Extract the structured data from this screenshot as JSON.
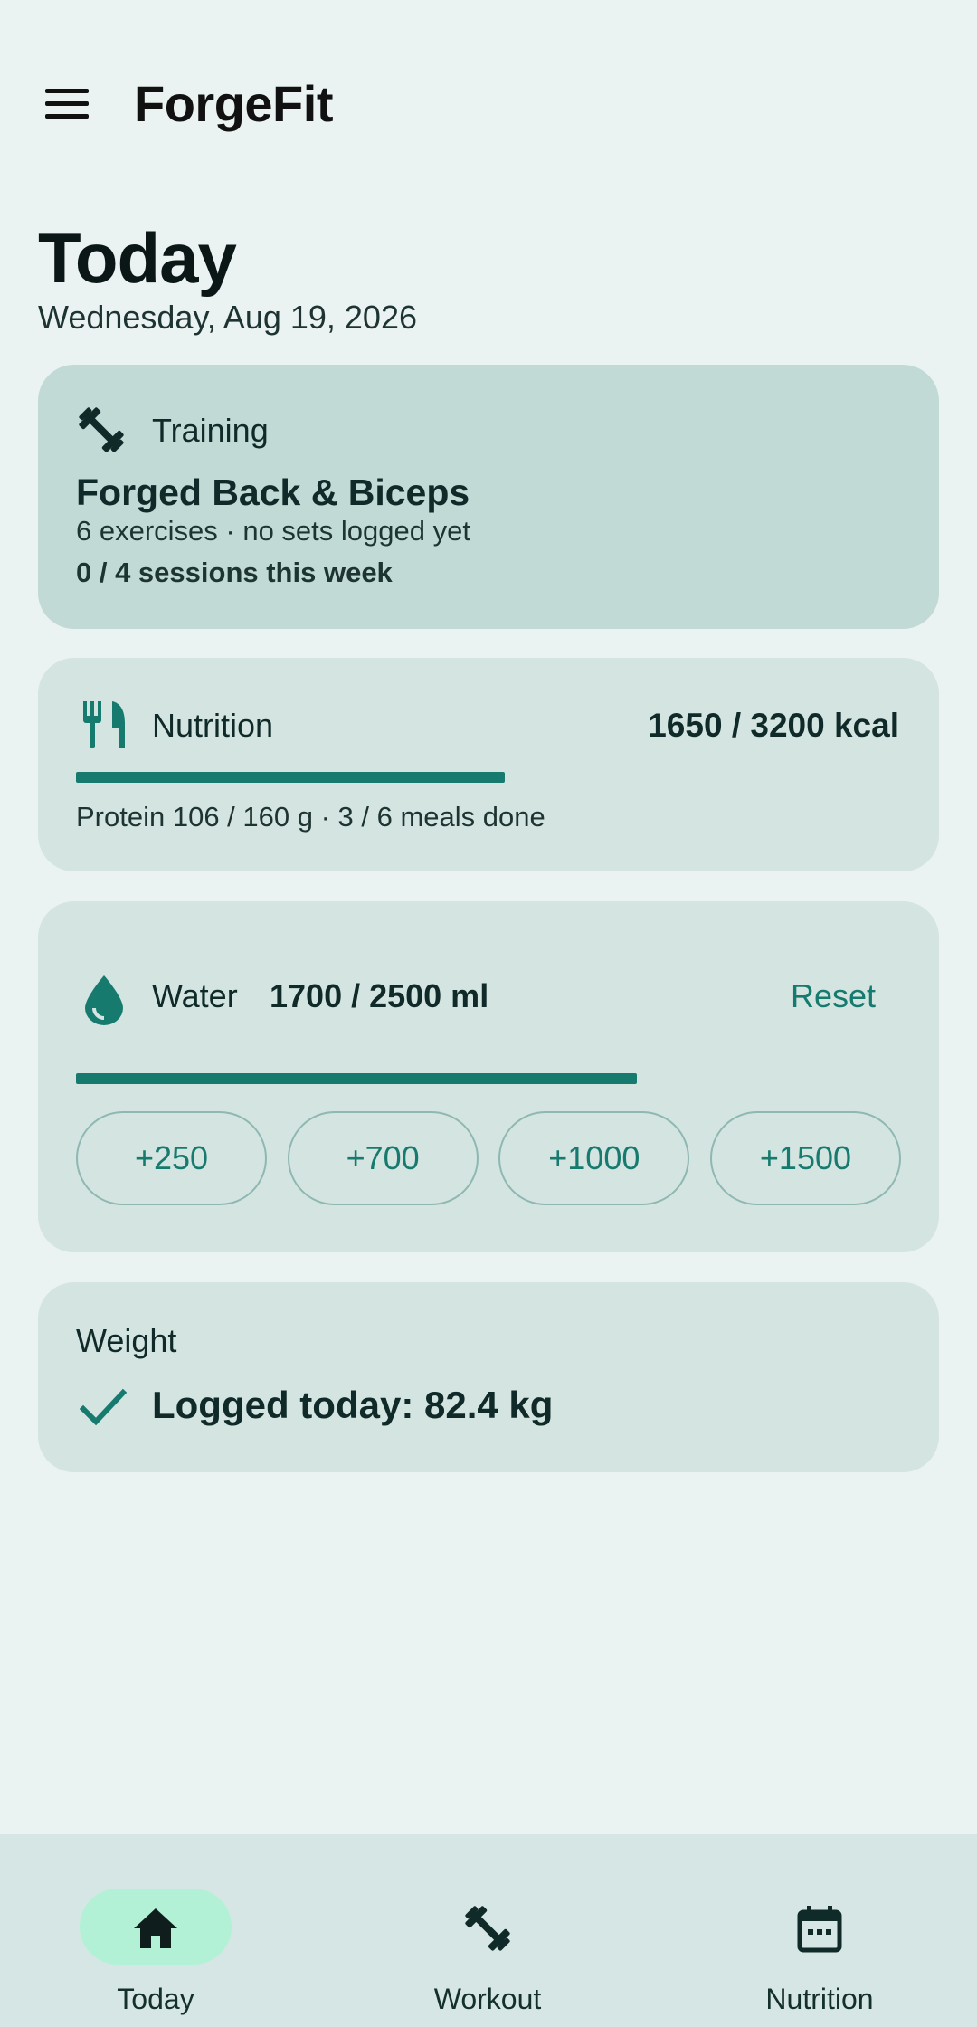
{
  "app": {
    "title": "ForgeFit"
  },
  "page": {
    "title": "Today",
    "date": "Wednesday, Aug 19, 2026"
  },
  "training": {
    "label": "Training",
    "plan": "Forged Back & Biceps",
    "subtitle": "6 exercises · no sets logged yet",
    "sessions": "0 / 4 sessions this week",
    "icon": "dumbbell-icon"
  },
  "nutrition": {
    "label": "Nutrition",
    "kcal": "1650 / 3200 kcal",
    "progress": 0.52,
    "subtitle": "Protein 106 / 160 g · 3 / 6 meals done",
    "icon": "utensils-icon"
  },
  "water": {
    "label": "Water",
    "amount": "1700 / 2500 ml",
    "reset_label": "Reset",
    "progress": 0.68,
    "chips": [
      "+250",
      "+700",
      "+1000",
      "+1500"
    ],
    "icon": "water-drop-icon"
  },
  "weight": {
    "label": "Weight",
    "logged": "Logged today: 82.4 kg",
    "icon": "check-icon"
  },
  "bottom_nav": {
    "items": [
      {
        "label": "Today",
        "icon": "home-icon",
        "active": true
      },
      {
        "label": "Workout",
        "icon": "dumbbell-icon",
        "active": false
      },
      {
        "label": "Nutrition",
        "icon": "calendar-icon",
        "active": false
      }
    ]
  },
  "colors": {
    "background": "#EAF3F2",
    "accent": "#167A6E",
    "nav_active_pill": "#B2F1D6",
    "training_card": "#C1DAD6",
    "card": "#D3E4E1"
  }
}
